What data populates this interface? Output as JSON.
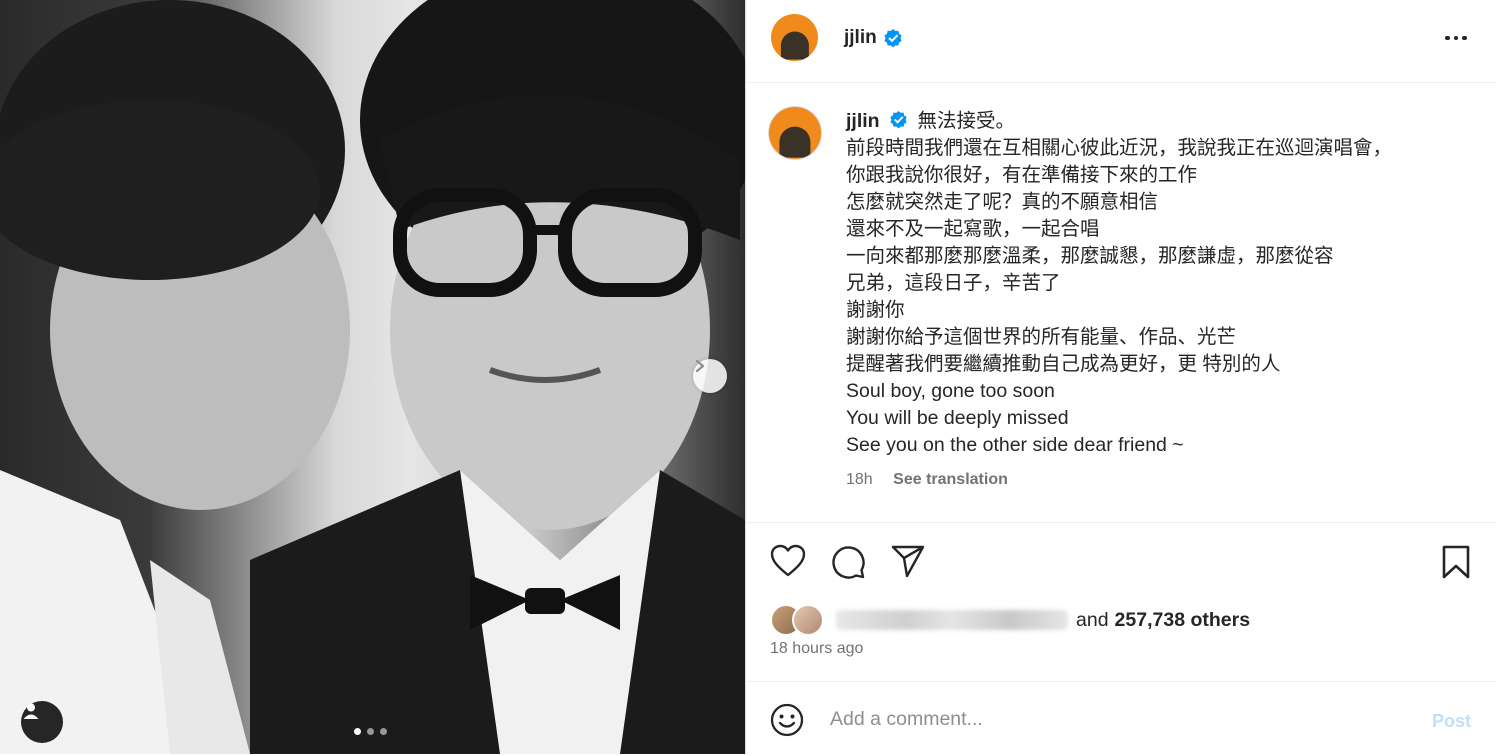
{
  "post": {
    "photo_alt": "black and white selfie of two men",
    "carousel": {
      "total": 3,
      "current": 1
    }
  },
  "header": {
    "username": "jjlin",
    "verified": true
  },
  "caption": {
    "username": "jjlin",
    "lines": [
      "無法接受。",
      "前段時間我們還在互相關心彼此近況，我說我正在巡迴演唱會，",
      "你跟我說你很好，有在準備接下來的工作",
      "怎麼就突然走了呢？真的不願意相信",
      "還來不及一起寫歌，一起合唱",
      "一向來都那麼那麼溫柔，那麼誠懇，那麼謙虛，那麼從容",
      "兄弟，這段日子，辛苦了",
      "謝謝你",
      "謝謝你給予這個世界的所有能量、作品、光芒",
      "提醒著我們要繼續推動自己成為更好，更 特別的人",
      "Soul boy, gone too soon",
      "You will be deeply missed",
      "See you on the other side dear friend ~"
    ],
    "time": "18h",
    "see_translation": "See translation"
  },
  "likes": {
    "connector": "and",
    "count_text": "257,738 others"
  },
  "timestamp": "18 hours ago",
  "comment": {
    "placeholder": "Add a comment...",
    "post_label": "Post"
  },
  "colors": {
    "verified_blue": "#0095f6",
    "avatar_orange": "#f08a1c",
    "post_disabled": "#c0dffd"
  },
  "icons": [
    "heart-icon",
    "comment-icon",
    "share-icon",
    "bookmark-icon",
    "emoji-icon",
    "more-icon",
    "chevron-right-icon",
    "user-tag-icon",
    "verified-icon"
  ]
}
